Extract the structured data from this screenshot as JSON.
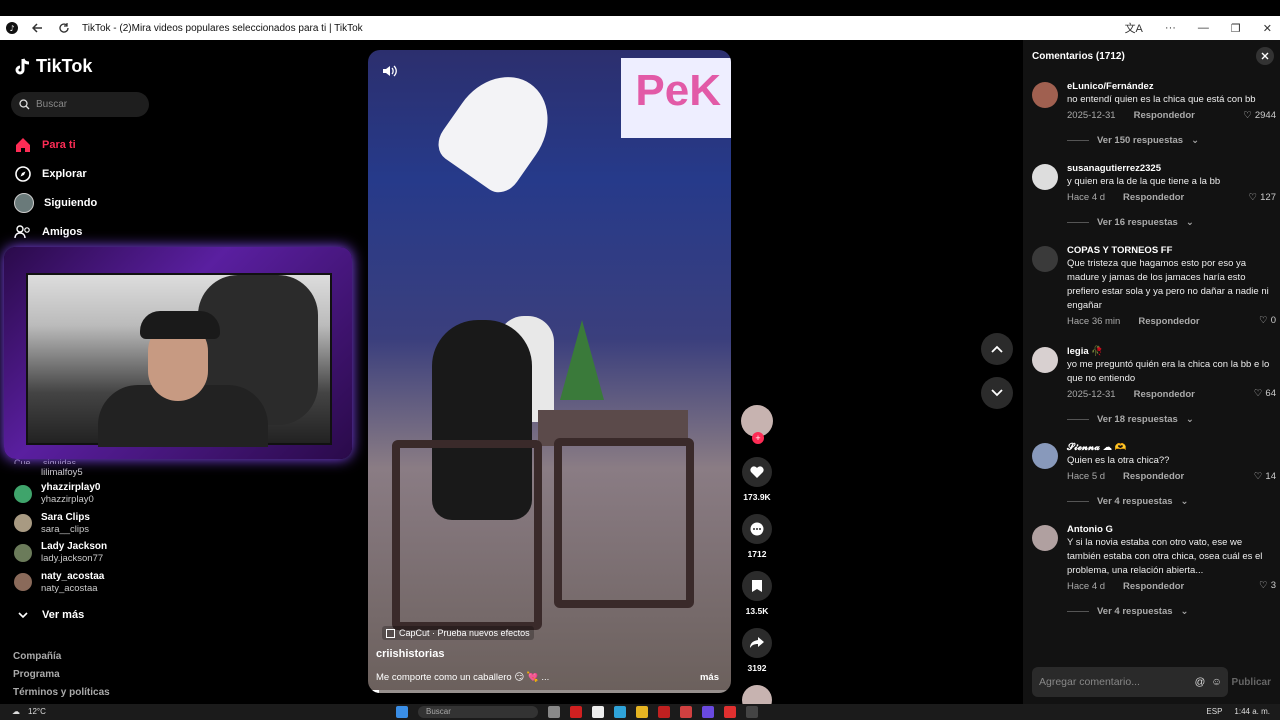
{
  "window": {
    "title": "TikTok - (2)Mira videos populares seleccionados para ti | TikTok"
  },
  "sidebar": {
    "logo": "TikTok",
    "search_placeholder": "Buscar",
    "nav": [
      {
        "label": "Para ti",
        "icon": "home-icon",
        "active": true
      },
      {
        "label": "Explorar",
        "icon": "compass-icon",
        "active": false
      },
      {
        "label": "Siguiendo",
        "icon": "avatar-icon",
        "active": false
      },
      {
        "label": "Amigos",
        "icon": "friends-icon",
        "active": false
      }
    ],
    "partial_section_label": "Cue ... siguidas",
    "partial_handle": "lilimalfoy5",
    "following": [
      {
        "name": "yhazzirplay0",
        "handle": "yhazzirplay0"
      },
      {
        "name": "Sara Clips",
        "handle": "sara__clips"
      },
      {
        "name": "Lady Jackson",
        "handle": "lady.jackson77"
      },
      {
        "name": "naty_acostaa",
        "handle": "naty_acostaa"
      }
    ],
    "see_more": "Ver más",
    "footer": [
      "Compañía",
      "Programa",
      "Términos y políticas"
    ]
  },
  "video": {
    "effect": "CapCut · Prueba nuevos efectos",
    "author": "criishistorias",
    "caption": "Me comporte como un caballero 😏 💘 ...",
    "more": "más",
    "sign_text": "PeK",
    "progress": 0.03
  },
  "actions": {
    "likes": "173.9K",
    "comments": "1712",
    "saves": "13.5K",
    "shares": "3192"
  },
  "comments": {
    "header": "Comentarios (1712)",
    "items": [
      {
        "user": "eLunico/Fernández",
        "text": "no entendí quien es la chica que está con bb",
        "date": "2025-12-31",
        "reply": "Respondedor",
        "likes": "2944",
        "replies": "Ver 150 respuestas"
      },
      {
        "user": "susanagutierrez2325",
        "text": "y quien era la de la que tiene a la bb",
        "date": "Hace 4 d",
        "reply": "Respondedor",
        "likes": "127",
        "replies": "Ver 16 respuestas"
      },
      {
        "user": "COPAS Y TORNEOS FF",
        "text": "Que tristeza que hagamos esto por eso ya madure y jamas de los jamaces haría esto prefiero estar sola y ya pero no dañar a nadie ni engañar",
        "date": "Hace 36 min",
        "reply": "Respondedor",
        "likes": "0",
        "replies": ""
      },
      {
        "user": "legia 🥀",
        "text": "yo me preguntó quién era la chica con la bb e lo que no entiendo",
        "date": "2025-12-31",
        "reply": "Respondedor",
        "likes": "64",
        "replies": "Ver 18 respuestas"
      },
      {
        "user": "𝓢𝓲𝓮𝓷𝓷𝓪 ☁ 🫶",
        "text": "Quien es la otra chica??",
        "date": "Hace 5 d",
        "reply": "Respondedor",
        "likes": "14",
        "replies": "Ver 4 respuestas"
      },
      {
        "user": "Antonio G",
        "text": "Y si la novia estaba con otro vato, ese we también estaba con otra chica, osea cuál es el problema, una relación abierta...",
        "date": "Hace 4 d",
        "reply": "Respondedor",
        "likes": "3",
        "replies": "Ver 4 respuestas"
      }
    ],
    "input_placeholder": "Agregar comentario...",
    "publish": "Publicar"
  },
  "taskbar": {
    "temp": "12°C",
    "search": "Buscar",
    "lang": "ESP",
    "time": "1:44 a. m."
  },
  "colors": {
    "accent": "#fe2c55",
    "panel": "#121212"
  }
}
